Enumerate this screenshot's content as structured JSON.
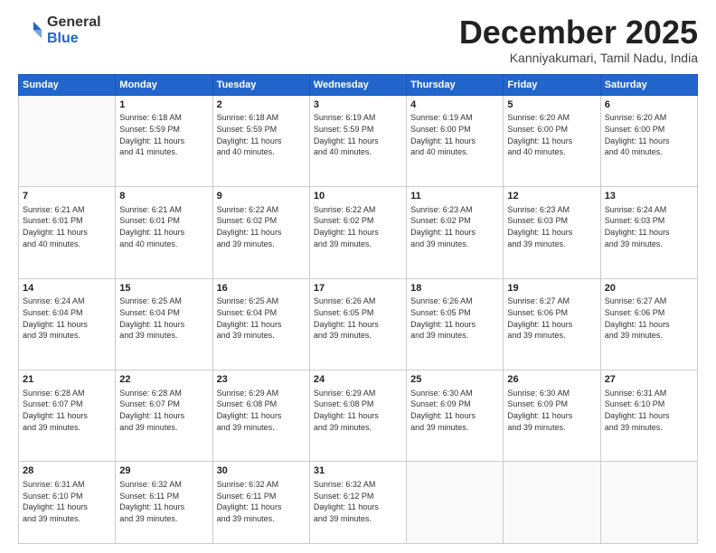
{
  "logo": {
    "general": "General",
    "blue": "Blue"
  },
  "header": {
    "month": "December 2025",
    "location": "Kanniyakumari, Tamil Nadu, India"
  },
  "weekdays": [
    "Sunday",
    "Monday",
    "Tuesday",
    "Wednesday",
    "Thursday",
    "Friday",
    "Saturday"
  ],
  "weeks": [
    [
      {
        "day": "",
        "info": ""
      },
      {
        "day": "1",
        "info": "Sunrise: 6:18 AM\nSunset: 5:59 PM\nDaylight: 11 hours\nand 41 minutes."
      },
      {
        "day": "2",
        "info": "Sunrise: 6:18 AM\nSunset: 5:59 PM\nDaylight: 11 hours\nand 40 minutes."
      },
      {
        "day": "3",
        "info": "Sunrise: 6:19 AM\nSunset: 5:59 PM\nDaylight: 11 hours\nand 40 minutes."
      },
      {
        "day": "4",
        "info": "Sunrise: 6:19 AM\nSunset: 6:00 PM\nDaylight: 11 hours\nand 40 minutes."
      },
      {
        "day": "5",
        "info": "Sunrise: 6:20 AM\nSunset: 6:00 PM\nDaylight: 11 hours\nand 40 minutes."
      },
      {
        "day": "6",
        "info": "Sunrise: 6:20 AM\nSunset: 6:00 PM\nDaylight: 11 hours\nand 40 minutes."
      }
    ],
    [
      {
        "day": "7",
        "info": "Sunrise: 6:21 AM\nSunset: 6:01 PM\nDaylight: 11 hours\nand 40 minutes."
      },
      {
        "day": "8",
        "info": "Sunrise: 6:21 AM\nSunset: 6:01 PM\nDaylight: 11 hours\nand 40 minutes."
      },
      {
        "day": "9",
        "info": "Sunrise: 6:22 AM\nSunset: 6:02 PM\nDaylight: 11 hours\nand 39 minutes."
      },
      {
        "day": "10",
        "info": "Sunrise: 6:22 AM\nSunset: 6:02 PM\nDaylight: 11 hours\nand 39 minutes."
      },
      {
        "day": "11",
        "info": "Sunrise: 6:23 AM\nSunset: 6:02 PM\nDaylight: 11 hours\nand 39 minutes."
      },
      {
        "day": "12",
        "info": "Sunrise: 6:23 AM\nSunset: 6:03 PM\nDaylight: 11 hours\nand 39 minutes."
      },
      {
        "day": "13",
        "info": "Sunrise: 6:24 AM\nSunset: 6:03 PM\nDaylight: 11 hours\nand 39 minutes."
      }
    ],
    [
      {
        "day": "14",
        "info": "Sunrise: 6:24 AM\nSunset: 6:04 PM\nDaylight: 11 hours\nand 39 minutes."
      },
      {
        "day": "15",
        "info": "Sunrise: 6:25 AM\nSunset: 6:04 PM\nDaylight: 11 hours\nand 39 minutes."
      },
      {
        "day": "16",
        "info": "Sunrise: 6:25 AM\nSunset: 6:04 PM\nDaylight: 11 hours\nand 39 minutes."
      },
      {
        "day": "17",
        "info": "Sunrise: 6:26 AM\nSunset: 6:05 PM\nDaylight: 11 hours\nand 39 minutes."
      },
      {
        "day": "18",
        "info": "Sunrise: 6:26 AM\nSunset: 6:05 PM\nDaylight: 11 hours\nand 39 minutes."
      },
      {
        "day": "19",
        "info": "Sunrise: 6:27 AM\nSunset: 6:06 PM\nDaylight: 11 hours\nand 39 minutes."
      },
      {
        "day": "20",
        "info": "Sunrise: 6:27 AM\nSunset: 6:06 PM\nDaylight: 11 hours\nand 39 minutes."
      }
    ],
    [
      {
        "day": "21",
        "info": "Sunrise: 6:28 AM\nSunset: 6:07 PM\nDaylight: 11 hours\nand 39 minutes."
      },
      {
        "day": "22",
        "info": "Sunrise: 6:28 AM\nSunset: 6:07 PM\nDaylight: 11 hours\nand 39 minutes."
      },
      {
        "day": "23",
        "info": "Sunrise: 6:29 AM\nSunset: 6:08 PM\nDaylight: 11 hours\nand 39 minutes."
      },
      {
        "day": "24",
        "info": "Sunrise: 6:29 AM\nSunset: 6:08 PM\nDaylight: 11 hours\nand 39 minutes."
      },
      {
        "day": "25",
        "info": "Sunrise: 6:30 AM\nSunset: 6:09 PM\nDaylight: 11 hours\nand 39 minutes."
      },
      {
        "day": "26",
        "info": "Sunrise: 6:30 AM\nSunset: 6:09 PM\nDaylight: 11 hours\nand 39 minutes."
      },
      {
        "day": "27",
        "info": "Sunrise: 6:31 AM\nSunset: 6:10 PM\nDaylight: 11 hours\nand 39 minutes."
      }
    ],
    [
      {
        "day": "28",
        "info": "Sunrise: 6:31 AM\nSunset: 6:10 PM\nDaylight: 11 hours\nand 39 minutes."
      },
      {
        "day": "29",
        "info": "Sunrise: 6:32 AM\nSunset: 6:11 PM\nDaylight: 11 hours\nand 39 minutes."
      },
      {
        "day": "30",
        "info": "Sunrise: 6:32 AM\nSunset: 6:11 PM\nDaylight: 11 hours\nand 39 minutes."
      },
      {
        "day": "31",
        "info": "Sunrise: 6:32 AM\nSunset: 6:12 PM\nDaylight: 11 hours\nand 39 minutes."
      },
      {
        "day": "",
        "info": ""
      },
      {
        "day": "",
        "info": ""
      },
      {
        "day": "",
        "info": ""
      }
    ]
  ]
}
